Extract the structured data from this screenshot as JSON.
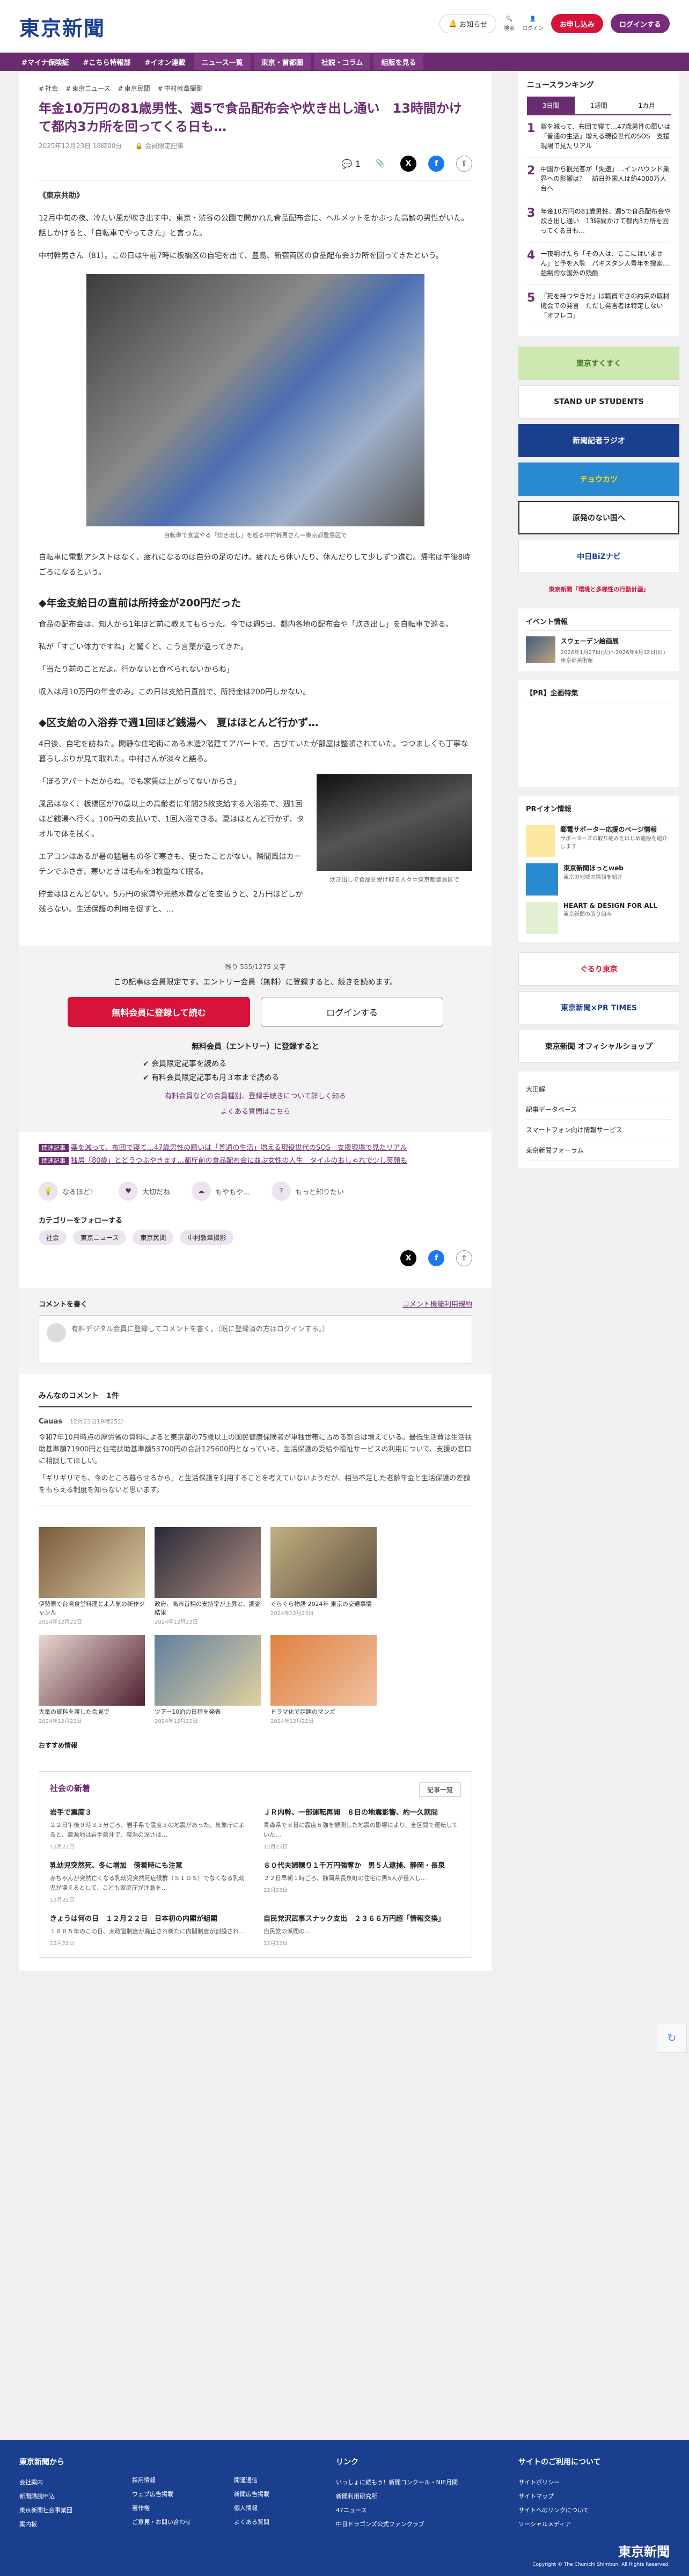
{
  "header": {
    "logo": "東京新聞",
    "notice_label": "お知らせ",
    "search_label": "検索",
    "login_label": "ログイン",
    "register_label": "お申し込み",
    "member_label": "ログインする"
  },
  "nav": [
    "#マイナ保険証",
    "#こちら特報部",
    "#イオン連載",
    "ニュース一覧",
    "東京・首都圏",
    "社説・コラム",
    "組版を見る"
  ],
  "breadcrumb": [
    "社会",
    "東京ニュース",
    "東京民間",
    "中村敦章撮影"
  ],
  "article": {
    "title": "年金10万円の81歳男性、週5で食品配布会や炊き出し通い　13時間かけて都内3カ所を回ってくる日も…",
    "date": "2025年12月23日 18時00分",
    "author_badge": "会員限定記事",
    "comment_count": "1",
    "dateline": "《東京共助》",
    "p1": "12月中旬の夜、冷たい風が吹き出す中、東京・渋谷の公園で開かれた食品配布会に、ヘルメットをかぶった高齢の男性がいた。話しかけると、「自転車でやってきた」と言った。",
    "p2": "中村幹男さん（81）。この日は午前7時に板橋区の自宅を出て、豊島、新宿両区の食品配布会3カ所を回ってきたという。",
    "caption": "自転車で食堂やる「炊き出し」を巡る中村幹男さん＝東京都豊島区で",
    "p3": "自転車に電動アシストはなく、疲れになるのは自分の足のだけ。疲れたら休いたり、休んだりして少しずつ進む。帰宅は午後8時ごろになるという。",
    "h2a": "◆年金支給日の直前は所持金が200円だった",
    "p4": "食品の配布会は、知人から1年ほど前に教えてもらった。今では週5日、都内各地の配布会や「炊き出し」を自転車で巡る。",
    "p5": "私が「すごい体力ですね」と驚くと、こう言葉が返ってきた。",
    "p6": "「当たり前のことだよ。行かないと食べられないからね」",
    "p7": "収入は月10万円の年金のみ。この日は支給日直前で、所持金は200円しかない。",
    "h2b": "◆区支給の入浴券で週1回ほど銭湯へ　夏はほとんど行かず…",
    "p8": "4日後、自宅を訪ねた。閑静な住宅街にある木造2階建てアパートで、古びていたが部屋は整頓されていた。つつましくも丁寧な暮らしぶりが見て取れた。中村さんが淡々と語る。",
    "p9": "「ぼろアパートだからね。でも家賃は上がってないからさ」",
    "p10": "風呂はなく、板橋区が70歳以上の高齢者に年間25枚支給する入浴券で、週1回ほど銭湯へ行く。100円の支払いで、1回入浴できる。夏はほとんど行かず、タオルで体を拭く。",
    "p11": "エアコンはあるが暑の猛暑もの冬で寒さも、使ったことがない。隣間風はカーテンでふさぎ、寒いときは毛布を3枚重ねて眠る。",
    "p12": "貯金はほとんどない。5万円の家賃や光熱水費などを支払うと、2万円ほどしか残らない。生活保護の利用を促すと、…",
    "float_caption": "炊き出しで食品を受け取る人々＝東京都豊島区で"
  },
  "gate": {
    "count": "残り 555/1275 文字",
    "msg": "この記事は会員限定です。エントリー会員（無料）に登録すると、続きを読めます。",
    "btn_register": "無料会員に登録して読む",
    "btn_login": "ログインする",
    "entry_title": "無料会員（エントリー）に登録すると",
    "benefit1": "会員限定記事を読める",
    "benefit2": "有料会員限定記事も月３本まで読める",
    "link1": "有料会員などの会員種別、登録手続きについて詳しく知る",
    "link2": "よくある質問はこちら"
  },
  "related": [
    {
      "tag": "関連記事",
      "text": "薬を減って、布団で寝て…47歳男性の願いは「普通の生活」増える現役世代のSOS　支援現場で見たリアル"
    },
    {
      "tag": "関連記事",
      "text": "独居「80歳」とどうつぶやきます…都庁前の食品配布会に並ぶ女性の人生　タイルのおしゃれで少し笑顔も"
    }
  ],
  "reactions": [
    "なるほど！",
    "大切だね",
    "もやもや…",
    "もっと知りたい"
  ],
  "follow": {
    "title": "カテゴリーをフォローする",
    "tags": [
      "社会",
      "東京ニュース",
      "東京民間",
      "中村敦章撮影"
    ]
  },
  "comments": {
    "title": "コメントを書く",
    "guide": "コメント機能利用規約",
    "prompt": "有料デジタル会員に登録してコメントを書く。（既に登録済の方はログインする。）",
    "everyone": "みんなのコメント　1件",
    "user": "Cauas",
    "udate": "12月23日19時25分",
    "body": "令和7年10月時点の厚労省の資料によると東京都の75歳以上の国民健康保険者が単独世帯に占める割合は増えている。最低生活費は生活扶助基準額71900円と住宅扶助基準額53700円の合計125600円となっている。生活保護の受給や福祉サービスの利用について、支援の窓口に相談してほしい。",
    "body2": "「ギリギリでも、今のところ暮らせるから」と生活保護を利用することを考えていないようだが、相当不足した老齢年金と生活保護の差額をもらえる制度を知らないと思います。"
  },
  "thumbs": [
    {
      "t": "伊勢原で台湾食堂料理とよ人気の新作ジャンル",
      "d": "2024年12月22日"
    },
    {
      "t": "政府、高市首相の支持率が上昇と、調査結果",
      "d": "2024年12月23日"
    },
    {
      "t": "ぐらぐら物語 2024年 東京の交通事情",
      "d": "2024年12月23日"
    },
    {
      "t": "大量の資料を渡した会見で",
      "d": "2024年12月22日"
    },
    {
      "t": "ツアー10泊の日程を発表",
      "d": "2024年12月22日"
    },
    {
      "t": "ドラマ化で話題のマンガ",
      "d": "2024年12月22日"
    }
  ],
  "recommend_label": "おすすめ情報",
  "social": {
    "title": "社会の新着",
    "more": "記事一覧",
    "items": [
      {
        "t": "岩手で震度３",
        "d": "２２日午後９時３３分ごろ、岩手県で震度３の地震があった。気象庁によると、震源地は岩手県沖で、震源の深さは…",
        "dt": "12月22日"
      },
      {
        "t": "ＪＲ内幹、一部運転再開　８日の地震影響、約一久就問",
        "d": "青森県で８日に震度６強を観測した地震の影響により、全区間で運転していた…",
        "dt": "12月22日"
      },
      {
        "t": "乳幼児突然死、冬に増加　傍着時にも注意",
        "d": "赤ちゃんが突然亡くなる乳幼児突然死症候群（ＳＩＤＳ）でなくなる乳幼児が増えるとして、こども家庭庁が注意を…",
        "dt": "12月22日"
      },
      {
        "t": "８０代夫婦轢り１千万円強奪か　男５人逮捕、静岡・長泉",
        "d": "２２日早朝１時ごろ、静岡県長泉町の住宅に男5人が侵入し…",
        "dt": "12月22日"
      },
      {
        "t": "きょうは何の日　１２月２２日　日本初の内閣が組閣",
        "d": "１８８５年のこの日、太政官制度が廃止され新たに内閣制度が創設され…",
        "dt": "12月22日"
      },
      {
        "t": "自民党沢武事スナック支出　２３６６万円超「情報交換」",
        "d": "自民党の派閥の…",
        "dt": "12月22日"
      }
    ]
  },
  "sidebar": {
    "ranking_title": "ニュースランキング",
    "tabs": [
      "3日間",
      "1週間",
      "1カ月"
    ],
    "ranks": [
      {
        "n": "1",
        "t": "薬を減って、布団で寝て…47歳男性の願いは「普通の生活」増える現役世代のSOS　支援現場で見たリアル"
      },
      {
        "n": "2",
        "t": "中国から観光客が「失速」…インバウンド業界への影響は？　訪日外国人は約4000万人台へ"
      },
      {
        "n": "3",
        "t": "年金10万円の81歳男性、週5で食品配布会や炊き出し通い　13時間かけて都内3カ所を回ってくる日も…"
      },
      {
        "n": "4",
        "t": "一夜明けたら「その人は、ここにはいません」と予を入覧　パキスタン人青年を捜索…強制的な国外の残酷"
      },
      {
        "n": "5",
        "t": "「死を持つやきだ」は職員でさの約束の取材機会での発言　ただし発言者は特定しない「オフレコ」"
      }
    ],
    "banners": [
      "東京すくすく",
      "STAND UP STUDENTS",
      "新聞記者ラジオ",
      "チョウカツ",
      "原発のない国へ",
      "中日BiZナビ",
      "東京新聞「環境と多様性の行動計画」"
    ],
    "event_title": "イベント情報",
    "event_text": "スウェーデン絵画展",
    "event_date": "2026年1月27日(火)～2026年4月12日(日)　東京都美術館",
    "pr_title": "【PR】企画特集",
    "pr2_title": "PRイオン情報",
    "pr_items": [
      {
        "t": "郵電サポーター応援のページ情報",
        "d": "サポーターズの取り組みをはじめ施設を紹介します"
      },
      {
        "t": "東京新聞ほっとweb",
        "d": "東京の地域の情報を紹介"
      },
      {
        "t": "HEART & DESIGN FOR ALL",
        "d": "東京新聞の取り組み"
      }
    ],
    "banners2": [
      "ぐるり東京",
      "東京新聞×PR TIMES",
      "東京新聞 オフィシャルショップ"
    ],
    "links": [
      "大田解",
      "記事データベース",
      "スマートフォン向け情報サービス",
      "東京新聞フォーラム"
    ]
  },
  "footer": {
    "c1": "東京新聞から",
    "c1items": [
      "会社案内",
      "新聞購読申込",
      "東京新聞社会事業団",
      "案内板"
    ],
    "c2items": [
      "採用情報",
      "ウェブ広告掲載",
      "著作権",
      "ご意見・お問い合わせ"
    ],
    "c3items": [
      "開運通信",
      "新聞広告掲載",
      "個人情報",
      "よくある質問"
    ],
    "c4": "リンク",
    "c4items": [
      "いっしょに続もう！新聞コンクール・NIE月間",
      "新聞利用研究所",
      "47ニュース",
      "中日ドラゴンズ公式ファンクラブ"
    ],
    "c5": "サイトのご利用について",
    "c5items": [
      "サイトポリシー",
      "サイトマップ",
      "サイトへのリンクについて",
      "ソーシャルメディア"
    ],
    "logo": "東京新聞",
    "copy": "Copyright © The Chunichi Shimbun, All Rights Reserved."
  }
}
